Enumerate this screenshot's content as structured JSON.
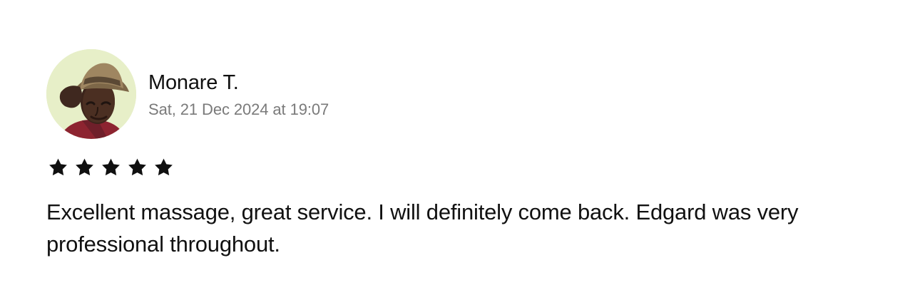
{
  "review": {
    "reviewer_name": "Monare T.",
    "date": "Sat, 21 Dec 2024 at 19:07",
    "rating": 5,
    "stars": [
      "star-icon",
      "star-icon",
      "star-icon",
      "star-icon",
      "star-icon"
    ],
    "text": "Excellent massage, great service. I will definitely come back. Edgard was very professional throughout."
  },
  "colors": {
    "text_primary": "#101010",
    "text_secondary": "#7a7a7a",
    "star": "#101010",
    "avatar_background": "#e7efc8"
  }
}
